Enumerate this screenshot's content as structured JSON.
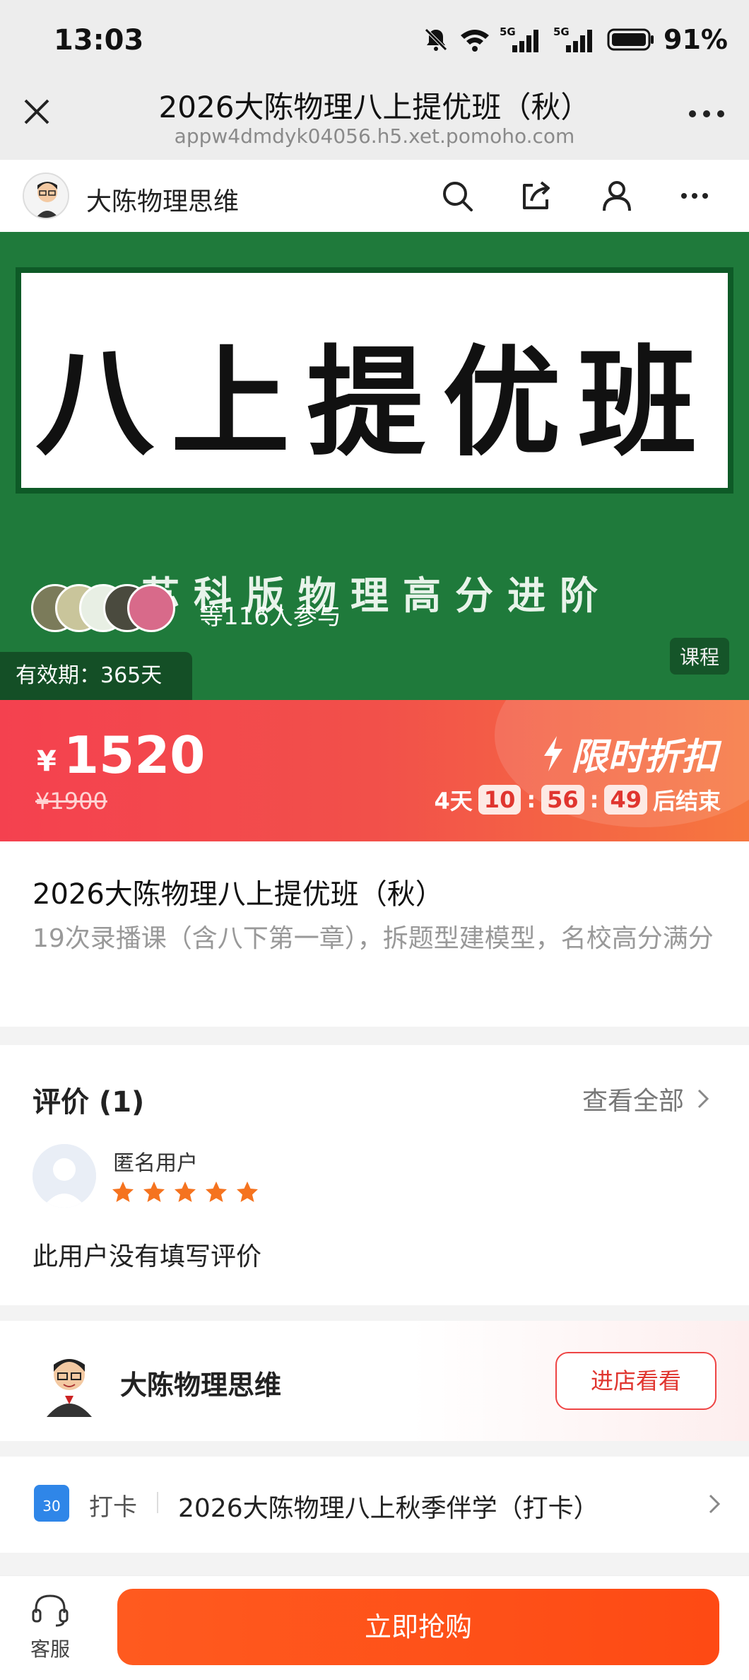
{
  "status_bar": {
    "time": "13:03",
    "battery": "91%",
    "network_1": "5G",
    "network_2": "5G"
  },
  "title_bar": {
    "title": "2026大陈物理八上提优班（秋）",
    "url": "appw4dmdyk04056.h5.xet.pomoho.com",
    "close_icon": "close-icon",
    "more_icon": "more-dots-icon"
  },
  "shop_header": {
    "name": "大陈物理思维",
    "icons": [
      "search-icon",
      "share-icon",
      "user-icon",
      "more-icon"
    ]
  },
  "banner": {
    "title": "八上提优班",
    "subtitle": "苏科版物理高分进阶",
    "joined": "等116人参与",
    "validity": "有效期：365天",
    "tag": "课程",
    "accent": "#1f7a3b"
  },
  "price": {
    "currency": "¥",
    "current": "1520",
    "original": "¥1900",
    "discount_label": "限时折扣",
    "countdown": {
      "days": "4天",
      "hours": "10",
      "minutes": "56",
      "seconds": "49",
      "suffix": "后结束"
    }
  },
  "course": {
    "title": "2026大陈物理八上提优班（秋）",
    "description": "19次录播课（含八下第一章），拆题型建模型，名校高分满分"
  },
  "reviews": {
    "title": "评价 (1)",
    "view_all": "查看全部",
    "items": [
      {
        "user": "匿名用户",
        "rating": 5,
        "text": "此用户没有填写评价"
      }
    ]
  },
  "shop_card": {
    "name": "大陈物理思维",
    "button": "进店看看"
  },
  "checkin": {
    "icon_text": "30",
    "label": "打卡",
    "text": "2026大陈物理八上秋季伴学（打卡）"
  },
  "bottom_bar": {
    "service_label": "客服",
    "buy_label": "立即抢购",
    "buy_color": "#ff5a1f"
  }
}
